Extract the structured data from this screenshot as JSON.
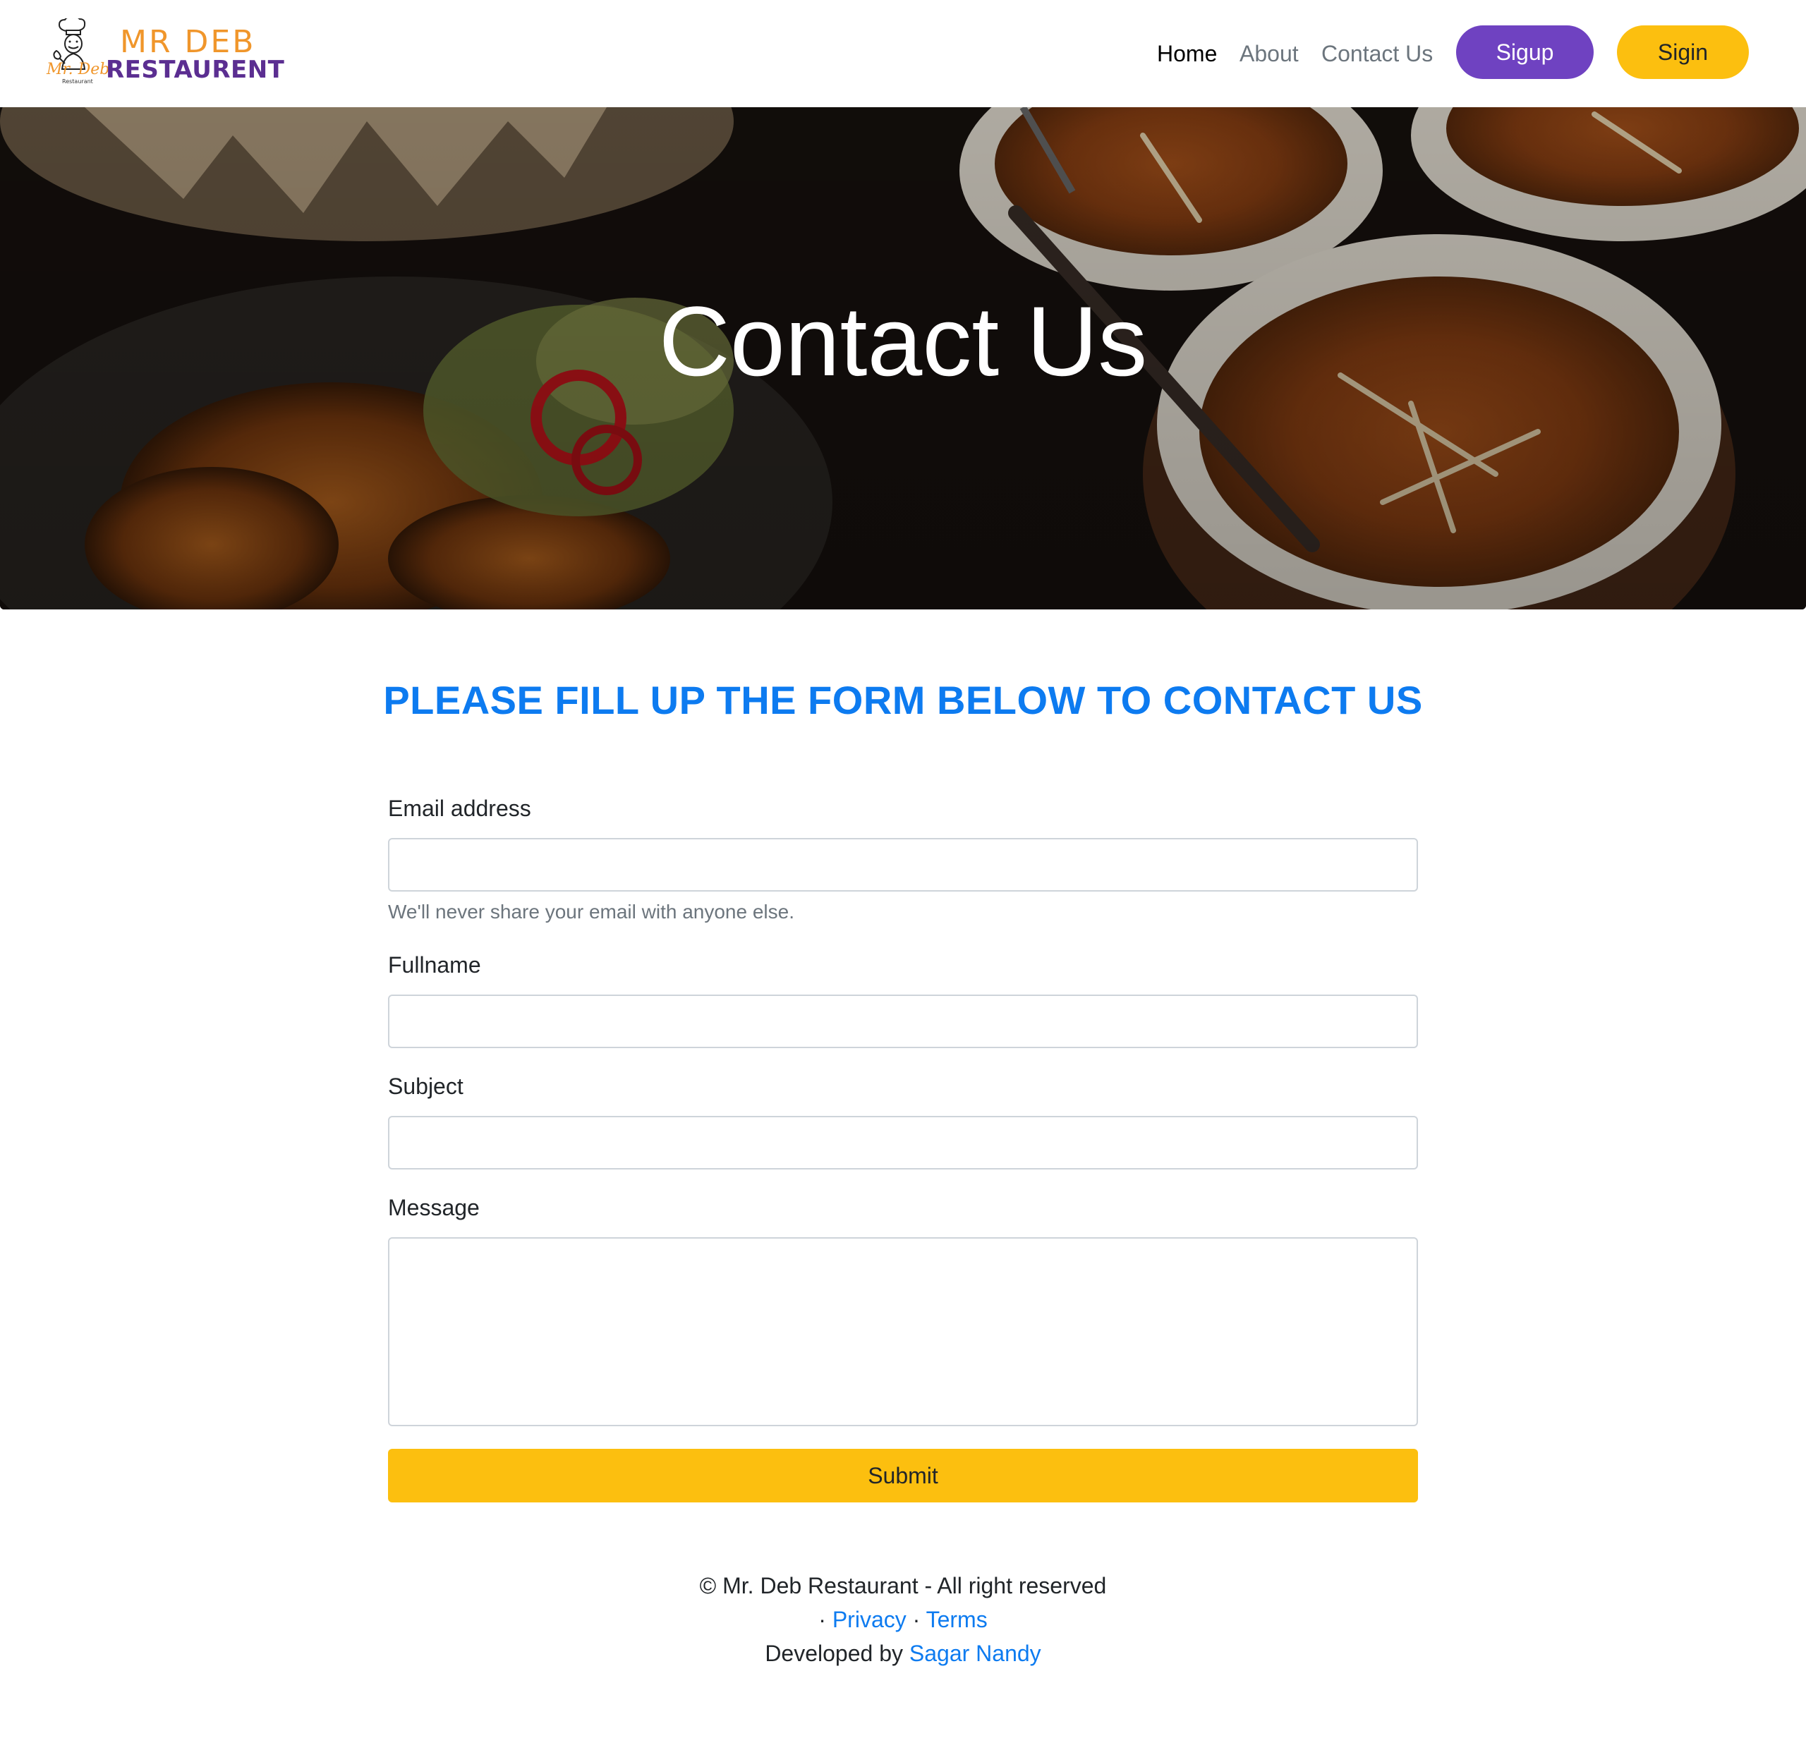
{
  "brand": {
    "name_line1": "MR DEB",
    "name_line2": "RESTAURENT",
    "script": "Mr. Deb",
    "tiny": "Restaurant",
    "logo_icon": "chef-icon",
    "colors": {
      "orange": "#f0962b",
      "purple": "#5b2e91"
    }
  },
  "nav": {
    "home": "Home",
    "about": "About",
    "contact": "Contact Us",
    "signup": "Sigup",
    "signin": "Sigin"
  },
  "hero": {
    "title": "Contact Us"
  },
  "form": {
    "heading": "PLEASE FILL UP THE FORM BELOW TO CONTACT US",
    "email_label": "Email address",
    "email_value": "",
    "email_help": "We'll never share your email with anyone else.",
    "fullname_label": "Fullname",
    "fullname_value": "",
    "subject_label": "Subject",
    "subject_value": "",
    "message_label": "Message",
    "message_value": "",
    "submit": "Submit"
  },
  "footer": {
    "copyright": "© Mr. Deb Restaurant - All right reserved",
    "separator": "·",
    "privacy": "Privacy",
    "terms": "Terms",
    "developed_by": "Developed by",
    "developer": "Sagar Nandy"
  },
  "colors": {
    "primary_link": "#0d7bf0",
    "signup_bg": "#6f42c1",
    "signin_bg": "#fcbf0f",
    "submit_bg": "#fcbf0f"
  }
}
